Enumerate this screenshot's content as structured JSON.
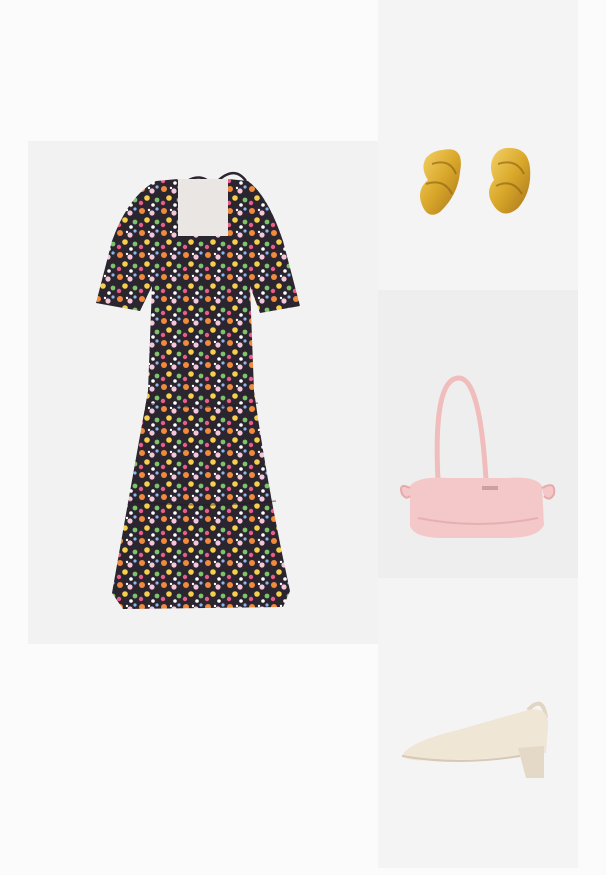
{
  "outfit": {
    "items": [
      {
        "name": "floral-midi-dress",
        "icon": "dress-icon"
      },
      {
        "name": "gold-knot-earrings",
        "icon": "earrings-icon"
      },
      {
        "name": "pink-shoulder-bag",
        "icon": "bag-icon"
      },
      {
        "name": "cream-slingback-heel",
        "icon": "shoe-icon"
      }
    ],
    "colors": {
      "background": "#fbfbfb",
      "tile": "#f2f2f2",
      "dress_base": "#2b2530",
      "gold": "#d9a82a",
      "bag_pink": "#f2c4c4",
      "shoe_cream": "#efe6d6"
    }
  }
}
